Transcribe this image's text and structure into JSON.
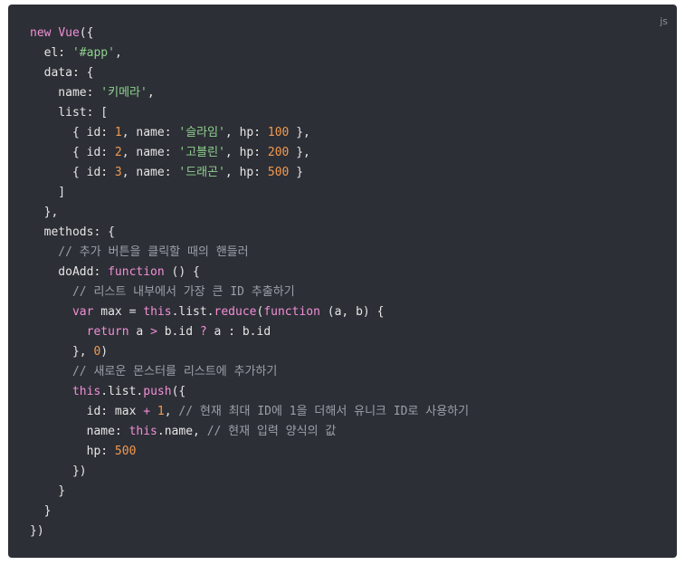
{
  "code_block": {
    "language_label": "js",
    "lines": [
      [
        {
          "t": "k",
          "v": "new"
        },
        {
          "t": "p",
          "v": " "
        },
        {
          "t": "k",
          "v": "Vue"
        },
        {
          "t": "p",
          "v": "({"
        }
      ],
      [
        {
          "t": "p",
          "v": "  el: "
        },
        {
          "t": "s",
          "v": "'#app'"
        },
        {
          "t": "p",
          "v": ","
        }
      ],
      [
        {
          "t": "p",
          "v": "  data: {"
        }
      ],
      [
        {
          "t": "p",
          "v": "    name: "
        },
        {
          "t": "s",
          "v": "'키메라'"
        },
        {
          "t": "p",
          "v": ","
        }
      ],
      [
        {
          "t": "p",
          "v": "    list: ["
        }
      ],
      [
        {
          "t": "p",
          "v": "      { id: "
        },
        {
          "t": "n",
          "v": "1"
        },
        {
          "t": "p",
          "v": ", name: "
        },
        {
          "t": "s",
          "v": "'슬라임'"
        },
        {
          "t": "p",
          "v": ", hp: "
        },
        {
          "t": "n",
          "v": "100"
        },
        {
          "t": "p",
          "v": " },"
        }
      ],
      [
        {
          "t": "p",
          "v": "      { id: "
        },
        {
          "t": "n",
          "v": "2"
        },
        {
          "t": "p",
          "v": ", name: "
        },
        {
          "t": "s",
          "v": "'고블린'"
        },
        {
          "t": "p",
          "v": ", hp: "
        },
        {
          "t": "n",
          "v": "200"
        },
        {
          "t": "p",
          "v": " },"
        }
      ],
      [
        {
          "t": "p",
          "v": "      { id: "
        },
        {
          "t": "n",
          "v": "3"
        },
        {
          "t": "p",
          "v": ", name: "
        },
        {
          "t": "s",
          "v": "'드래곤'"
        },
        {
          "t": "p",
          "v": ", hp: "
        },
        {
          "t": "n",
          "v": "500"
        },
        {
          "t": "p",
          "v": " }"
        }
      ],
      [
        {
          "t": "p",
          "v": "    ]"
        }
      ],
      [
        {
          "t": "p",
          "v": "  },"
        }
      ],
      [
        {
          "t": "p",
          "v": "  methods: {"
        }
      ],
      [
        {
          "t": "c",
          "v": "    // 추가 버튼을 클릭할 때의 핸들러"
        }
      ],
      [
        {
          "t": "p",
          "v": "    doAdd: "
        },
        {
          "t": "k",
          "v": "function"
        },
        {
          "t": "p",
          "v": " () {"
        }
      ],
      [
        {
          "t": "c",
          "v": "      // 리스트 내부에서 가장 큰 ID 추출하기"
        }
      ],
      [
        {
          "t": "p",
          "v": "      "
        },
        {
          "t": "k",
          "v": "var"
        },
        {
          "t": "p",
          "v": " max = "
        },
        {
          "t": "k",
          "v": "this"
        },
        {
          "t": "p",
          "v": ".list."
        },
        {
          "t": "k",
          "v": "reduce"
        },
        {
          "t": "p",
          "v": "("
        },
        {
          "t": "k",
          "v": "function"
        },
        {
          "t": "p",
          "v": " (a, b) {"
        }
      ],
      [
        {
          "t": "p",
          "v": "        "
        },
        {
          "t": "k",
          "v": "return"
        },
        {
          "t": "p",
          "v": " a "
        },
        {
          "t": "o",
          "v": ">"
        },
        {
          "t": "p",
          "v": " b.id "
        },
        {
          "t": "o",
          "v": "?"
        },
        {
          "t": "p",
          "v": " a : b.id"
        }
      ],
      [
        {
          "t": "p",
          "v": "      }, "
        },
        {
          "t": "n",
          "v": "0"
        },
        {
          "t": "p",
          "v": ")"
        }
      ],
      [
        {
          "t": "c",
          "v": "      // 새로운 몬스터를 리스트에 추가하기"
        }
      ],
      [
        {
          "t": "p",
          "v": "      "
        },
        {
          "t": "k",
          "v": "this"
        },
        {
          "t": "p",
          "v": ".list."
        },
        {
          "t": "k",
          "v": "push"
        },
        {
          "t": "p",
          "v": "({"
        }
      ],
      [
        {
          "t": "p",
          "v": "        id: max "
        },
        {
          "t": "o",
          "v": "+"
        },
        {
          "t": "p",
          "v": " "
        },
        {
          "t": "n",
          "v": "1"
        },
        {
          "t": "p",
          "v": ", "
        },
        {
          "t": "c",
          "v": "// 현재 최대 ID에 1을 더해서 유니크 ID로 사용하기"
        }
      ],
      [
        {
          "t": "p",
          "v": "        name: "
        },
        {
          "t": "k",
          "v": "this"
        },
        {
          "t": "p",
          "v": ".name, "
        },
        {
          "t": "c",
          "v": "// 현재 입력 양식의 값"
        }
      ],
      [
        {
          "t": "p",
          "v": "        hp: "
        },
        {
          "t": "n",
          "v": "500"
        }
      ],
      [
        {
          "t": "p",
          "v": "      })"
        }
      ],
      [
        {
          "t": "p",
          "v": "    }"
        }
      ],
      [
        {
          "t": "p",
          "v": "  }"
        }
      ],
      [
        {
          "t": "p",
          "v": "})"
        }
      ]
    ]
  }
}
